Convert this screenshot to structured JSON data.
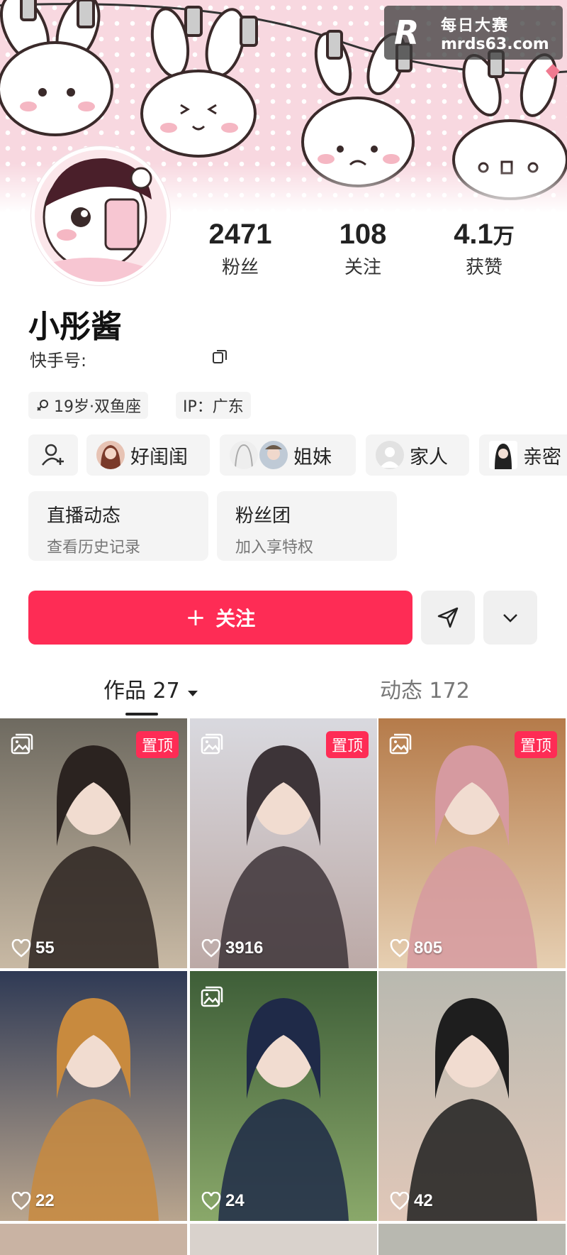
{
  "watermark": {
    "line1": "每日大赛",
    "line2": "mrds63.com"
  },
  "profile": {
    "name": "小彤酱",
    "kuaishou_id_label": "快手号:",
    "stats": [
      {
        "number": "2471",
        "unit": "",
        "label": "粉丝"
      },
      {
        "number": "108",
        "unit": "",
        "label": "关注"
      },
      {
        "number": "4.1",
        "unit": "万",
        "label": "获赞"
      }
    ],
    "tags": {
      "age_sign": "19岁·双鱼座",
      "ip": "IP：广东"
    }
  },
  "relations": {
    "friend": "好闺闺",
    "sister": "姐妹",
    "family": "家人",
    "close": "亲密"
  },
  "cards": {
    "live": {
      "title": "直播动态",
      "sub": "查看历史记录"
    },
    "fan_group": {
      "title": "粉丝团",
      "sub": "加入享特权"
    }
  },
  "actions": {
    "follow_plus": "+",
    "follow_label": "关注"
  },
  "tabs": {
    "works": "作品 27",
    "moments": "动态 172"
  },
  "grid": {
    "pin_label": "置顶",
    "likes": [
      "55",
      "3916",
      "805",
      "22",
      "24",
      "42"
    ]
  },
  "colors": {
    "accent": "#fe2c55",
    "banner_pink": "#f8d8e0"
  }
}
